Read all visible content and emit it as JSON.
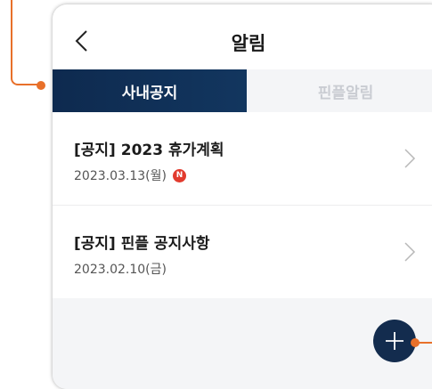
{
  "header": {
    "title": "알림"
  },
  "tabs": [
    {
      "label": "사내공지",
      "active": true
    },
    {
      "label": "핀플알림",
      "active": false
    }
  ],
  "notices": [
    {
      "title": "[공지] 2023 휴가계획",
      "date": "2023.03.13(월)",
      "badge": "N"
    },
    {
      "title": "[공지] 핀플 공지사항",
      "date": "2023.02.10(금)",
      "badge": ""
    }
  ],
  "icons": {
    "back": "chevron-left-icon",
    "row_arrow": "chevron-right-icon",
    "fab": "plus-icon"
  },
  "colors": {
    "accent_navy": "#132c4e",
    "callout_orange": "#e8702a",
    "new_badge_red": "#e23b2e"
  }
}
